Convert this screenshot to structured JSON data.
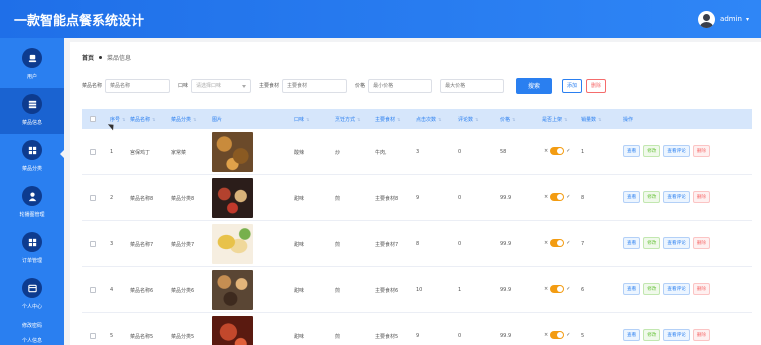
{
  "app": {
    "title": "一款智能点餐系统设计"
  },
  "user": {
    "name": "admin",
    "caret": "▾"
  },
  "sidebar": {
    "items": [
      {
        "label": "用户",
        "icon": "user-icon"
      },
      {
        "label": "菜品信息",
        "icon": "menu-icon",
        "active": true
      },
      {
        "label": "菜品分类",
        "icon": "grid-icon"
      },
      {
        "label": "轮播图管理",
        "icon": "person-icon"
      },
      {
        "label": "订单管理",
        "icon": "grid-icon"
      },
      {
        "label": "个人中心",
        "icon": "card-icon"
      }
    ],
    "extra": [
      "修改密码",
      "个人信息"
    ]
  },
  "breadcrumb": {
    "home": "首页",
    "current": "菜品信息"
  },
  "filters": {
    "name_label": "菜品名称",
    "name_placeholder": "菜品名称",
    "taste_label": "口味",
    "taste_placeholder": "请选择口味",
    "ingredient_label": "主要食材",
    "ingredient_placeholder": "主要食材",
    "price_label": "价格",
    "price_min_placeholder": "最小价格",
    "price_max_placeholder": "最大价格",
    "search": "搜索",
    "add": "添加",
    "delete": "删除"
  },
  "table": {
    "headers": [
      "序号",
      "菜品名称",
      "菜品分类",
      "图片",
      "口味",
      "烹饪方式",
      "主要食材",
      "点击次数",
      "评论数",
      "价格",
      "是否上架",
      "销量数",
      "操作"
    ],
    "toggle_left": "×",
    "toggle_right": "✓",
    "actions": {
      "view": "查看",
      "edit": "修改",
      "comments": "查看评论",
      "delete": "删除"
    },
    "rows": [
      {
        "index": "1",
        "name": "宫保鸡丁",
        "category": "家常菜",
        "taste": "酸辣",
        "method": "炒",
        "ingredient": "牛肉,",
        "clicks": "3",
        "comments": "0",
        "price": "58",
        "sales": "1",
        "thumb": [
          "#6b4a2a",
          "#c98b3c",
          "#8a5a22"
        ]
      },
      {
        "index": "2",
        "name": "菜品名称8",
        "category": "菜品分类8",
        "taste": "甜味",
        "method": "煎",
        "ingredient": "主要食材8",
        "clicks": "9",
        "comments": "0",
        "price": "99.9",
        "sales": "8",
        "thumb": [
          "#2b1d1a",
          "#b3422e",
          "#d8b27a"
        ]
      },
      {
        "index": "3",
        "name": "菜品名称7",
        "category": "菜品分类7",
        "taste": "甜味",
        "method": "煎",
        "ingredient": "主要食材7",
        "clicks": "8",
        "comments": "0",
        "price": "99.9",
        "sales": "7",
        "thumb": [
          "#e8c24a",
          "#f0d89a",
          "#77b04c"
        ]
      },
      {
        "index": "4",
        "name": "菜品名称6",
        "category": "菜品分类6",
        "taste": "甜味",
        "method": "煎",
        "ingredient": "主要食材6",
        "clicks": "10",
        "comments": "1",
        "price": "99.9",
        "sales": "6",
        "thumb": [
          "#5a4634",
          "#c58e52",
          "#3d2a1e"
        ]
      },
      {
        "index": "5",
        "name": "菜品名称5",
        "category": "菜品分类5",
        "taste": "甜味",
        "method": "煎",
        "ingredient": "主要食材5",
        "clicks": "9",
        "comments": "0",
        "price": "99.9",
        "sales": "5",
        "thumb": [
          "#8a2a1a",
          "#c2482c",
          "#5a1a10"
        ]
      }
    ]
  },
  "colors": {
    "primary": "#2a7ff0",
    "sidebar_active": "#1a63d1",
    "toggle_on": "#f39c12",
    "danger": "#f56c6c",
    "success": "#67c23a"
  }
}
